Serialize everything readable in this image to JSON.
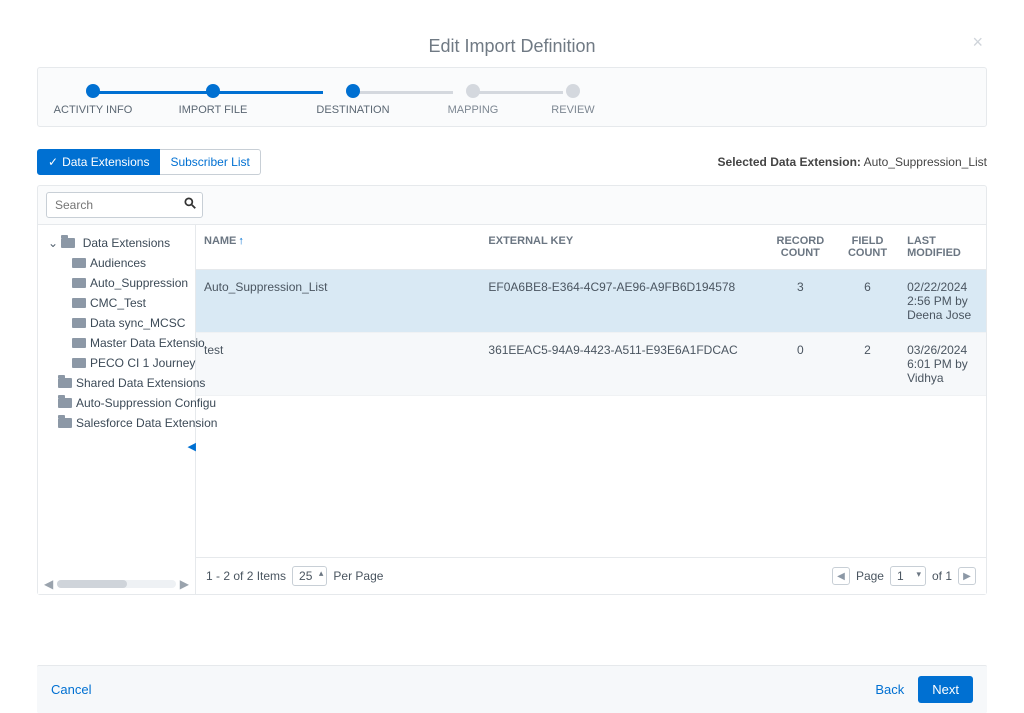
{
  "modal": {
    "title": "Edit Import Definition"
  },
  "wizard": {
    "steps": [
      {
        "label": "ACTIVITY INFO",
        "done": true
      },
      {
        "label": "IMPORT FILE",
        "done": true
      },
      {
        "label": "DESTINATION",
        "done": true
      },
      {
        "label": "MAPPING",
        "done": false
      },
      {
        "label": "REVIEW",
        "done": false
      }
    ]
  },
  "tabs": {
    "data_extensions": "Data Extensions",
    "subscriber_list": "Subscriber List"
  },
  "selected": {
    "label": "Selected Data Extension:",
    "value": "Auto_Suppression_List"
  },
  "search": {
    "placeholder": "Search"
  },
  "tree": {
    "root": "Data Extensions",
    "children": [
      "Audiences",
      "Auto_Suppression",
      "CMC_Test",
      "Data sync_MCSC",
      "Master Data Extensio",
      "PECO CI 1 Journey"
    ],
    "siblings": [
      "Shared Data Extensions",
      "Auto-Suppression Configu",
      "Salesforce Data Extension"
    ]
  },
  "columns": {
    "name": "NAME",
    "external_key": "EXTERNAL KEY",
    "record_count": "RECORD COUNT",
    "field_count": "FIELD COUNT",
    "last_modified": "LAST MODIFIED"
  },
  "rows": [
    {
      "name": "Auto_Suppression_List",
      "key": "EF0A6BE8-E364-4C97-AE96-A9FB6D194578",
      "record_count": "3",
      "field_count": "6",
      "modified": "02/22/2024 2:56 PM by Deena Jose",
      "selected": true
    },
    {
      "name": "test",
      "key": "361EEAC5-94A9-4423-A511-E93E6A1FDCAC",
      "record_count": "0",
      "field_count": "2",
      "modified": "03/26/2024 6:01 PM by Vidhya",
      "selected": false
    }
  ],
  "pagination": {
    "summary": "1 - 2 of 2 Items",
    "per_page_value": "25",
    "per_page_label": "Per Page",
    "page_label": "Page",
    "page_value": "1",
    "of_label": "of 1"
  },
  "footer": {
    "cancel": "Cancel",
    "back": "Back",
    "next": "Next"
  }
}
